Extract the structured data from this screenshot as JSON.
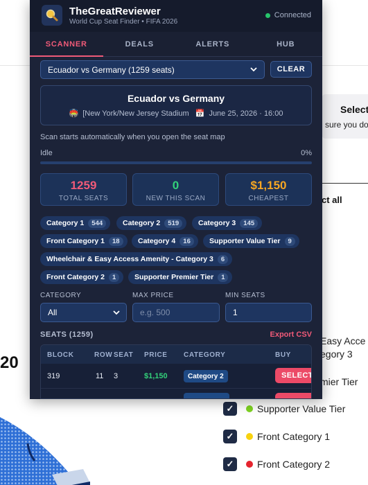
{
  "header": {
    "title": "TheGreatReviewer",
    "subtitle": "World Cup Seat Finder • FIFA 2026",
    "status": "Connected"
  },
  "tabs": [
    {
      "label": "SCANNER",
      "active": true
    },
    {
      "label": "DEALS",
      "active": false
    },
    {
      "label": "ALERTS",
      "active": false
    },
    {
      "label": "HUB",
      "active": false
    }
  ],
  "match_select": {
    "value": "Ecuador vs Germany (1259 seats)"
  },
  "clear_label": "CLEAR",
  "match_card": {
    "title": "Ecuador vs Germany",
    "venue": "[New York/New Jersey Stadium",
    "datetime": "June 25, 2026 · 16:00"
  },
  "scan": {
    "note": "Scan starts automatically when you open the seat map",
    "status": "Idle",
    "percent_label": "0%",
    "progress": 0
  },
  "stats": [
    {
      "value": "1259",
      "label": "TOTAL SEATS",
      "color": "#f05a78"
    },
    {
      "value": "0",
      "label": "NEW THIS SCAN",
      "color": "#33d17a"
    },
    {
      "value": "$1,150",
      "label": "CHEAPEST",
      "color": "#f5a623"
    }
  ],
  "category_chips": [
    {
      "label": "Category 1",
      "count": "544"
    },
    {
      "label": "Category 2",
      "count": "519"
    },
    {
      "label": "Category 3",
      "count": "145"
    },
    {
      "label": "Front Category 1",
      "count": "18"
    },
    {
      "label": "Category 4",
      "count": "16"
    },
    {
      "label": "Supporter Value Tier",
      "count": "9"
    },
    {
      "label": "Wheelchair & Easy Access Amenity - Category 3",
      "count": "6"
    },
    {
      "label": "Front Category 2",
      "count": "1"
    },
    {
      "label": "Supporter Premier Tier",
      "count": "1"
    }
  ],
  "filters": {
    "category_label": "CATEGORY",
    "category_value": "All",
    "max_price_label": "MAX PRICE",
    "max_price_placeholder": "e.g. 500",
    "min_seats_label": "MIN SEATS",
    "min_seats_value": "1"
  },
  "seats": {
    "heading": "SEATS (1259)",
    "export_label": "Export CSV",
    "columns": [
      "BLOCK",
      "ROW",
      "SEAT",
      "PRICE",
      "CATEGORY",
      "BUY"
    ],
    "rows": [
      {
        "block": "319",
        "row": "11",
        "seat": "3",
        "price": "$1,150",
        "category": "Category 2",
        "buy": "SELECT"
      }
    ]
  },
  "background": {
    "card_title": "Select",
    "card_sub": "sure you do",
    "select_all": "ct all",
    "frag_easy": "Easy Acce",
    "frag_egory": "egory 3",
    "frag_mier": "mier Tier",
    "big_number": "20",
    "legend": [
      {
        "label": "Supporter Value Tier",
        "color": "#7ed321"
      },
      {
        "label": "Front Category 1",
        "color": "#f8d20f"
      },
      {
        "label": "Front Category 2",
        "color": "#e5242e"
      }
    ]
  }
}
